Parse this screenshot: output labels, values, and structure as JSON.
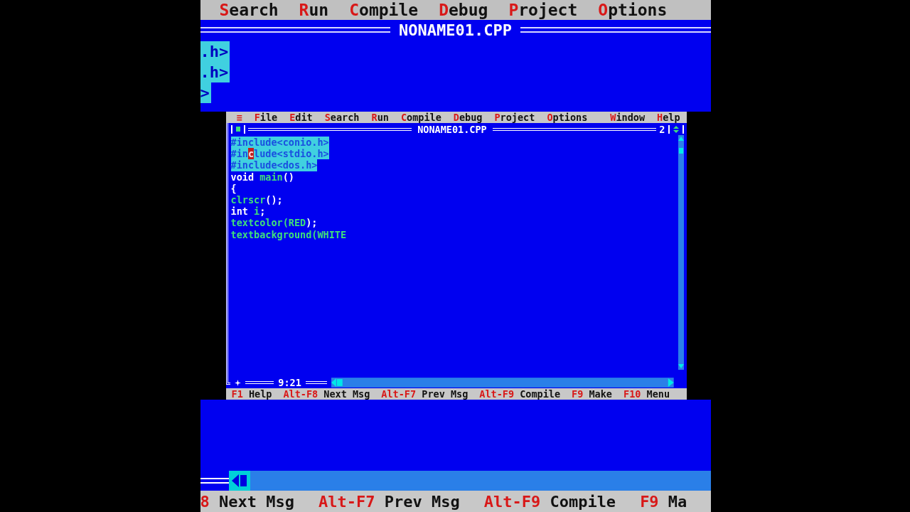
{
  "zoomed_view": {
    "menu": [
      {
        "key": "S",
        "rest": "earch"
      },
      {
        "key": "R",
        "rest": "un"
      },
      {
        "key": "C",
        "rest": "ompile"
      },
      {
        "key": "D",
        "rest": "ebug"
      },
      {
        "key": "P",
        "rest": "roject"
      },
      {
        "key": "O",
        "rest": "ptions"
      }
    ],
    "title": "NONAME01.CPP",
    "code_fragments": [
      ".h>",
      ".h>",
      ">"
    ],
    "status_bar": [
      {
        "key": "8",
        "label": "Next Msg"
      },
      {
        "key": "Alt-F7",
        "label": "Prev Msg"
      },
      {
        "key": "Alt-F9",
        "label": "Compile"
      },
      {
        "key": "F9",
        "label": "Ma"
      }
    ]
  },
  "ide": {
    "system_menu": "≡",
    "menu": [
      {
        "key": "F",
        "rest": "ile"
      },
      {
        "key": "E",
        "rest": "dit"
      },
      {
        "key": "S",
        "rest": "earch"
      },
      {
        "key": "R",
        "rest": "un"
      },
      {
        "key": "C",
        "rest": "ompile"
      },
      {
        "key": "D",
        "rest": "ebug"
      },
      {
        "key": "P",
        "rest": "roject"
      },
      {
        "key": "O",
        "rest": "ptions"
      },
      {
        "key": "W",
        "rest": "indow"
      },
      {
        "key": "H",
        "rest": "elp"
      }
    ],
    "window": {
      "title": "NONAME01.CPP",
      "number": "2",
      "position": "9:21"
    },
    "code": [
      {
        "selected": true,
        "tokens": [
          {
            "kind": "plain",
            "text": "#include<conio.h>"
          }
        ]
      },
      {
        "selected": true,
        "tokens": [
          {
            "kind": "plain",
            "text": "#in"
          },
          {
            "kind": "cursor",
            "text": "c"
          },
          {
            "kind": "plain",
            "text": "lude<stdio.h>"
          }
        ]
      },
      {
        "selected": true,
        "tokens": [
          {
            "kind": "plain",
            "text": "#include<dos.h>"
          }
        ]
      },
      {
        "selected": false,
        "tokens": [
          {
            "kind": "keyword",
            "text": "void "
          },
          {
            "kind": "ident",
            "text": "main"
          },
          {
            "kind": "keyword",
            "text": "()"
          }
        ]
      },
      {
        "selected": false,
        "tokens": [
          {
            "kind": "keyword",
            "text": "{"
          }
        ]
      },
      {
        "selected": false,
        "tokens": [
          {
            "kind": "ident",
            "text": "clrscr"
          },
          {
            "kind": "keyword",
            "text": "();"
          }
        ]
      },
      {
        "selected": false,
        "tokens": [
          {
            "kind": "keyword",
            "text": "int "
          },
          {
            "kind": "ident",
            "text": "i"
          },
          {
            "kind": "keyword",
            "text": ";"
          }
        ]
      },
      {
        "selected": false,
        "tokens": [
          {
            "kind": "ident",
            "text": "textcolor(RED"
          },
          {
            "kind": "keyword",
            "text": ");"
          }
        ]
      },
      {
        "selected": false,
        "tokens": [
          {
            "kind": "ident",
            "text": "textbackground(WHITE"
          }
        ]
      }
    ],
    "status_bar": [
      {
        "key": "F1",
        "label": "Help"
      },
      {
        "key": "Alt-F8",
        "label": "Next Msg"
      },
      {
        "key": "Alt-F7",
        "label": "Prev Msg"
      },
      {
        "key": "Alt-F9",
        "label": "Compile"
      },
      {
        "key": "F9",
        "label": "Make"
      },
      {
        "key": "F10",
        "label": "Menu"
      }
    ]
  }
}
